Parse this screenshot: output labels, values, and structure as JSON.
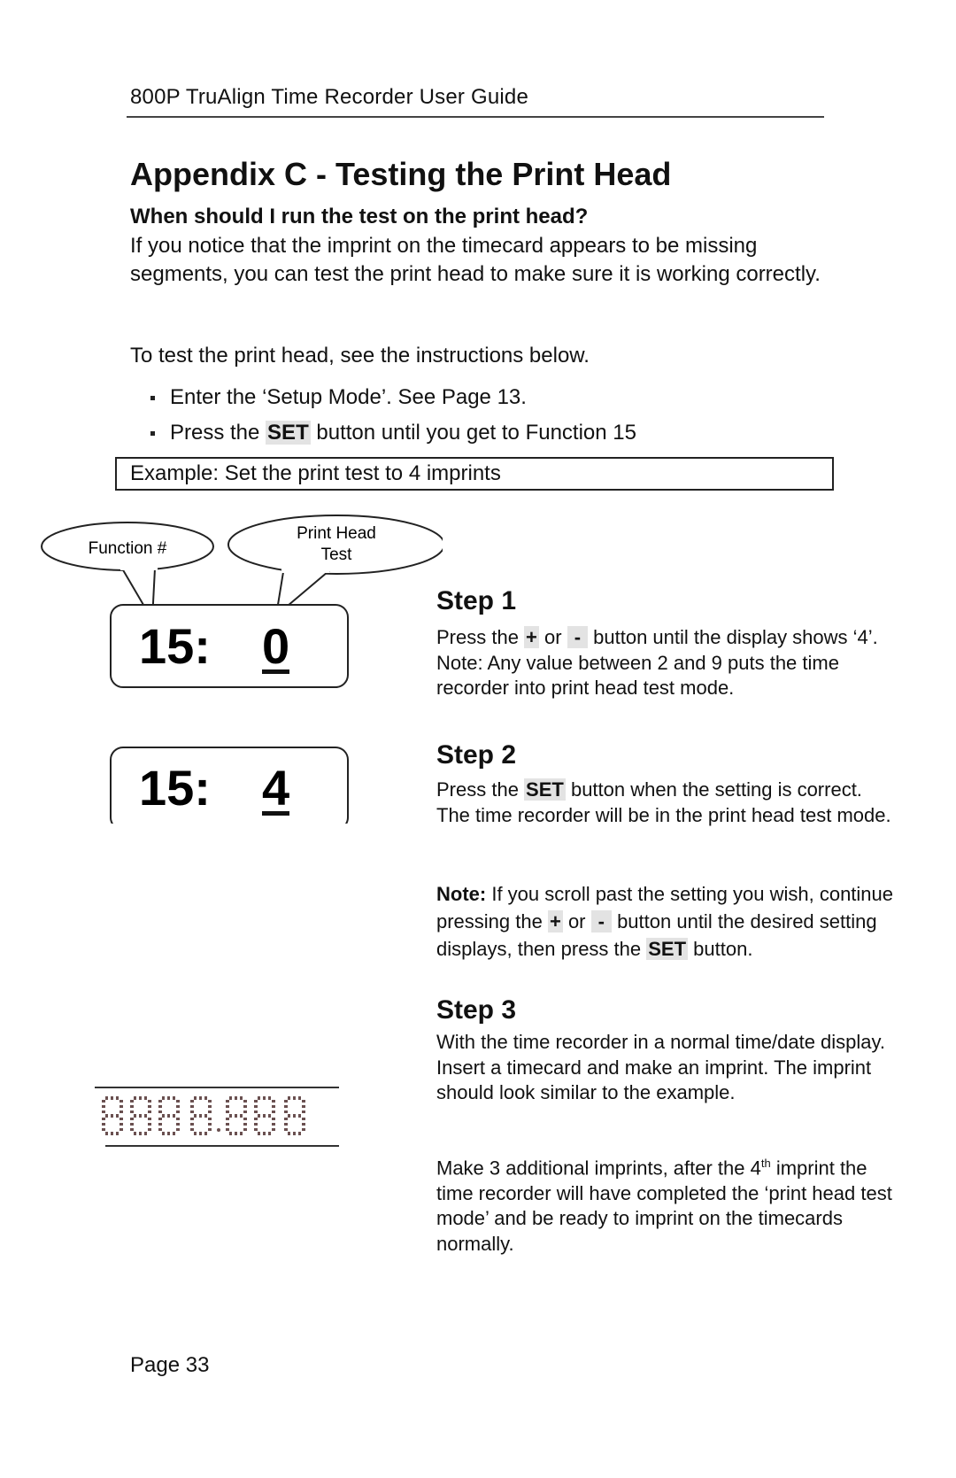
{
  "header": {
    "title": "800P TruAlign Time Recorder User Guide"
  },
  "page": {
    "title": "Appendix C - Testing the Print Head",
    "subheading": "When should I run the test on the print head?",
    "intro": "If you notice that the imprint on the timecard appears to be missing segments, you can test the print head to make sure it is working correctly.",
    "instructions_lead": "To test the print head, see the instructions below.",
    "bullets": [
      {
        "text": "Enter the ‘Setup Mode’. See Page 13."
      },
      {
        "before": "Press the ",
        "key": "SET",
        "after": " button until you get to Function 15"
      }
    ],
    "example_box": "Example: Set the print test to 4 imprints"
  },
  "diagram": {
    "callouts": {
      "function": "Function #",
      "print_head_line1": "Print Head",
      "print_head_line2": "Test"
    },
    "displays": [
      {
        "function": "15:",
        "value": "0"
      },
      {
        "function": "15:",
        "value": "4"
      }
    ],
    "imprint_example_label": "print-head-test-imprint"
  },
  "steps": [
    {
      "title": "Step 1",
      "parts": {
        "a": "Press the ",
        "plus": "+",
        "or": " or ",
        "minus": "-",
        "b": " button until the display shows ‘4’. Note: Any value between 2 and 9 puts the time recorder into print head test mode."
      }
    },
    {
      "title": "Step 2",
      "parts": {
        "a": "Press the ",
        "key": "SET",
        "b": " button when the setting is correct. The time recorder will be in the print head test mode."
      }
    },
    {
      "title": "Step 3",
      "body": "With the time recorder in a normal time/date display. Insert a timecard and make an imprint. The imprint should look similar to the example.",
      "extra_a": "Make 3 additional imprints, after the 4",
      "extra_sup": "th",
      "extra_b": " imprint the time recorder will have completed the ‘print head test mode’ and be ready to imprint on the timecards normally."
    }
  ],
  "note": {
    "label": "Note:",
    "a": " If you scroll past the setting you wish, continue pressing the ",
    "plus": "+",
    "or": " or ",
    "minus": "-",
    "b": " button until the desired setting displays, then press the ",
    "key": "SET",
    "c": " button."
  },
  "footer": {
    "page_number": "Page 33"
  }
}
